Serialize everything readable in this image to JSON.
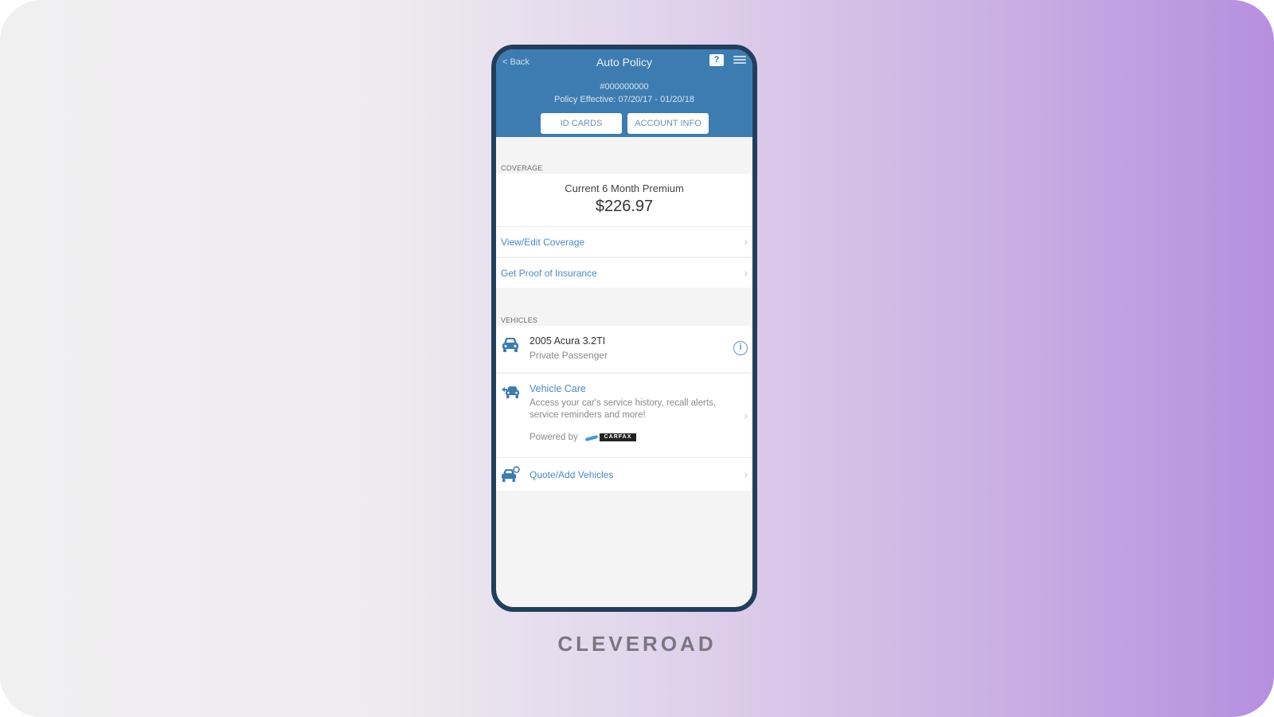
{
  "header": {
    "back_label": "< Back",
    "title": "Auto Policy",
    "help_label": "?",
    "policy_number": "#000000000",
    "policy_effective": "Policy Effective: 07/20/17 - 01/20/18",
    "buttons": [
      {
        "label": "ID CARDS"
      },
      {
        "label": "ACCOUNT INFO"
      }
    ]
  },
  "coverage": {
    "section_label": "COVERAGE",
    "premium_label": "Current 6 Month Premium",
    "premium_value": "$226.97",
    "links": [
      {
        "label": "View/Edit Coverage"
      },
      {
        "label": "Get Proof of Insurance"
      }
    ]
  },
  "vehicles": {
    "section_label": "VEHICLES",
    "vehicle": {
      "title": "2005 Acura 3.2TI",
      "subtitle": "Private Passenger",
      "info_label": "i"
    },
    "vehicle_care": {
      "title": "Vehicle Care",
      "description": "Access your car's service history, recall alerts, service reminders and more!",
      "powered_by": "Powered by",
      "partner_logo": "CARFAX"
    },
    "quote_add": {
      "label": "Quote/Add Vehicles"
    }
  },
  "icons": {
    "chevron": "›"
  },
  "colors": {
    "header_blue": "#3d7cb1",
    "frame_navy": "#233e5c",
    "link_blue": "#4a8ac2",
    "gradient_end": "#b68fdf"
  },
  "brand": {
    "name": "CLEVEROAD"
  }
}
